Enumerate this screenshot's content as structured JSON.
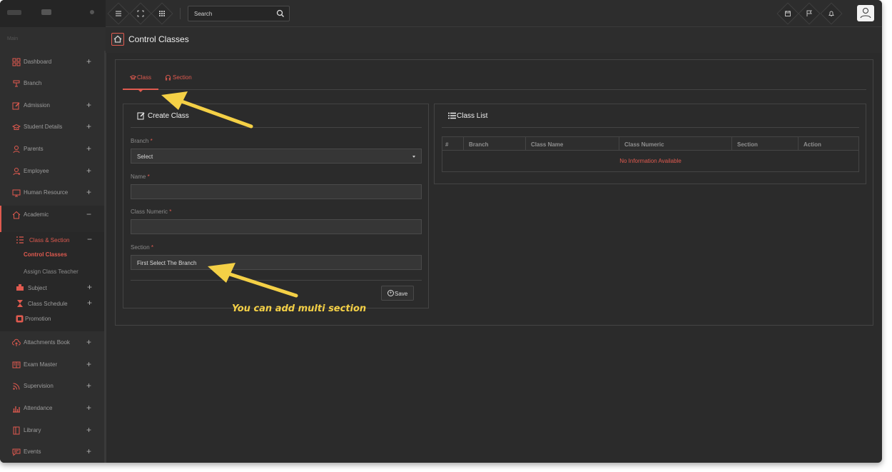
{
  "topbar": {
    "search_placeholder": "Search",
    "icons": [
      "menu-icon",
      "fullscreen-icon",
      "apps-grid-icon",
      "calendar-icon",
      "flag-icon",
      "bell-icon",
      "user-icon"
    ]
  },
  "sidebar": {
    "section_label": "Main",
    "items": [
      {
        "label": "Dashboard",
        "icon": "dashboard-icon",
        "expand": "+"
      },
      {
        "label": "Branch",
        "icon": "branch-icon",
        "expand": ""
      },
      {
        "label": "Admission",
        "icon": "edit-icon",
        "expand": "+"
      },
      {
        "label": "Student Details",
        "icon": "graduation-cap-icon",
        "expand": "+"
      },
      {
        "label": "Parents",
        "icon": "parents-icon",
        "expand": "+"
      },
      {
        "label": "Employee",
        "icon": "employee-icon",
        "expand": "+"
      },
      {
        "label": "Human Resource",
        "icon": "monitor-icon",
        "expand": "+"
      },
      {
        "label": "Academic",
        "icon": "home-icon",
        "expand": "−"
      }
    ],
    "academic_sub": {
      "class_section": {
        "label": "Class & Section",
        "expand": "−"
      },
      "control_classes": "Control Classes",
      "assign_teacher": "Assign Class Teacher",
      "subject": {
        "label": "Subject",
        "expand": "+"
      },
      "class_schedule": {
        "label": "Class Schedule",
        "expand": "+"
      },
      "promotion": "Promotion"
    },
    "items_after": [
      {
        "label": "Attachments Book",
        "icon": "cloud-upload-icon",
        "expand": "+"
      },
      {
        "label": "Exam Master",
        "icon": "book-icon",
        "expand": "+"
      },
      {
        "label": "Supervision",
        "icon": "rss-icon",
        "expand": "+"
      },
      {
        "label": "Attendance",
        "icon": "bar-chart-icon",
        "expand": "+"
      },
      {
        "label": "Library",
        "icon": "library-icon",
        "expand": "+"
      },
      {
        "label": "Events",
        "icon": "message-icon",
        "expand": "+"
      }
    ]
  },
  "page": {
    "title": "Control Classes"
  },
  "tabs": [
    {
      "label": "Class"
    },
    {
      "label": "Section"
    }
  ],
  "create_class": {
    "title": "Create Class",
    "branch_label": "Branch",
    "branch_value": "Select",
    "name_label": "Name",
    "class_numeric_label": "Class Numeric",
    "section_label": "Section",
    "section_value": "First Select The Branch",
    "required_mark": "*",
    "save_label": "Save"
  },
  "class_list": {
    "title": "Class List",
    "columns": [
      "#",
      "Branch",
      "Class Name",
      "Class Numeric",
      "Section",
      "Action"
    ],
    "empty_message": "No Information Available"
  },
  "annotation": {
    "text": "You can add multi section",
    "color": "#f4d046"
  },
  "colors": {
    "accent": "#e05a4f",
    "background": "#2b2b2b",
    "annotation": "#f4d046"
  }
}
